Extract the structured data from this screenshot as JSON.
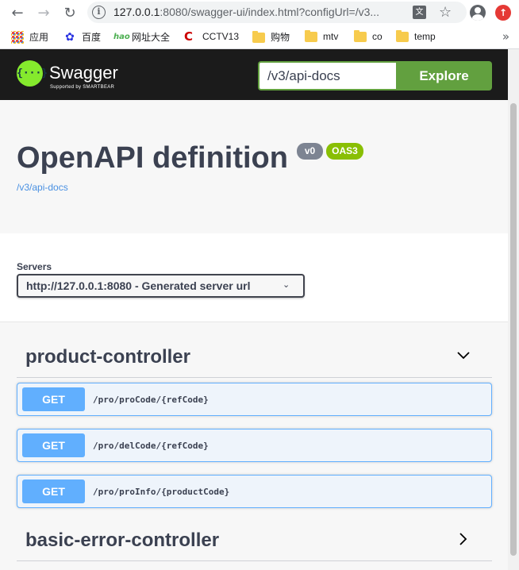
{
  "browser": {
    "url_host": "127.0.0.1",
    "url_rest": ":8080/swagger-ui/index.html?configUrl=/v3...",
    "bookmarks": [
      {
        "label": "应用",
        "icon": "apps-icon"
      },
      {
        "label": "百度",
        "icon": "baidu-icon"
      },
      {
        "label": "网址大全",
        "icon": "hao123-icon"
      },
      {
        "label": "CCTV13",
        "icon": "cctv-icon"
      },
      {
        "label": "购物",
        "icon": "folder-icon"
      },
      {
        "label": "mtv",
        "icon": "folder-icon"
      },
      {
        "label": "co",
        "icon": "folder-icon"
      },
      {
        "label": "temp",
        "icon": "folder-icon"
      }
    ],
    "more": "»"
  },
  "swagger": {
    "logo_glyph": "{···}",
    "brand": "Swagger",
    "tagline": "Supported by SMARTBEAR",
    "spec_input": "/v3/api-docs",
    "explore_label": "Explore"
  },
  "info": {
    "title": "OpenAPI definition",
    "version_badge": "v0",
    "oas_badge": "OAS3",
    "spec_link": "/v3/api-docs"
  },
  "servers": {
    "label": "Servers",
    "selected": "http://127.0.0.1:8080 - Generated server url"
  },
  "tags": [
    {
      "name": "product-controller",
      "expanded": true,
      "operations": [
        {
          "method": "GET",
          "path": "/pro/proCode/{refCode}"
        },
        {
          "method": "GET",
          "path": "/pro/delCode/{refCode}"
        },
        {
          "method": "GET",
          "path": "/pro/proInfo/{productCode}"
        }
      ]
    },
    {
      "name": "basic-error-controller",
      "expanded": false,
      "operations": []
    }
  ],
  "colors": {
    "accent": "#62a03f",
    "get_method": "#61affe",
    "header_bg": "#1b1b1b"
  }
}
